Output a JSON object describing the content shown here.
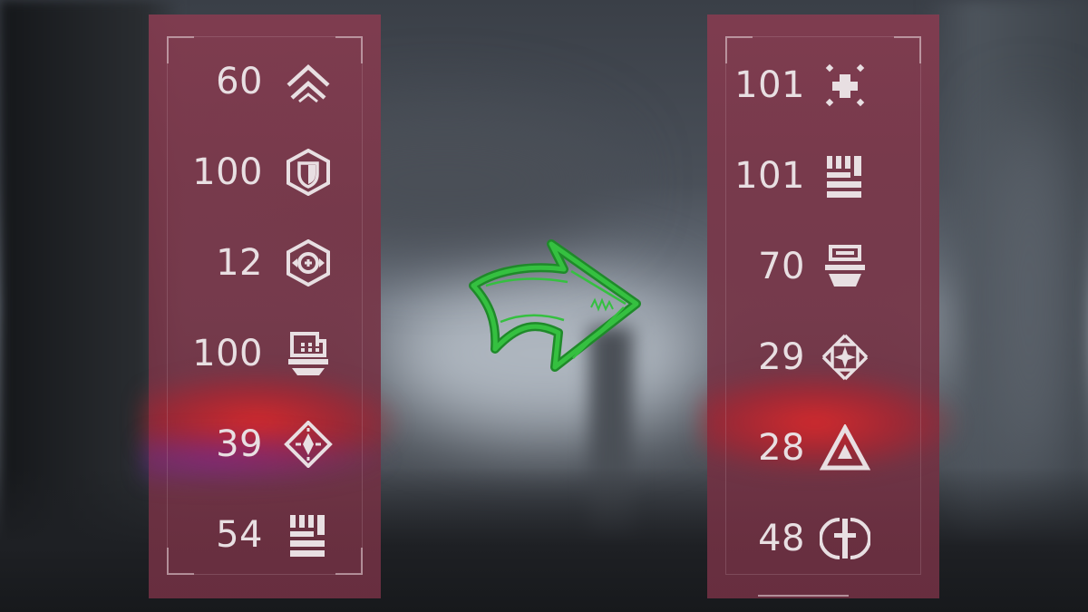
{
  "left_panel": {
    "stats": [
      {
        "value": "60",
        "icon": "mobility-icon"
      },
      {
        "value": "100",
        "icon": "resilience-icon"
      },
      {
        "value": "12",
        "icon": "recovery-icon"
      },
      {
        "value": "100",
        "icon": "discipline-icon"
      },
      {
        "value": "39",
        "icon": "intellect-icon"
      },
      {
        "value": "54",
        "icon": "strength-icon"
      }
    ]
  },
  "right_panel": {
    "stats": [
      {
        "value": "101",
        "icon": "health-icon"
      },
      {
        "value": "101",
        "icon": "melee-icon"
      },
      {
        "value": "70",
        "icon": "grenade-icon"
      },
      {
        "value": "29",
        "icon": "super-icon"
      },
      {
        "value": "28",
        "icon": "class-icon"
      },
      {
        "value": "48",
        "icon": "weapons-icon"
      }
    ]
  },
  "colors": {
    "panel": "#843c50",
    "text": "#e8dfe2",
    "arrow": "#35c040",
    "arrow_outline": "#1f8a2a"
  }
}
